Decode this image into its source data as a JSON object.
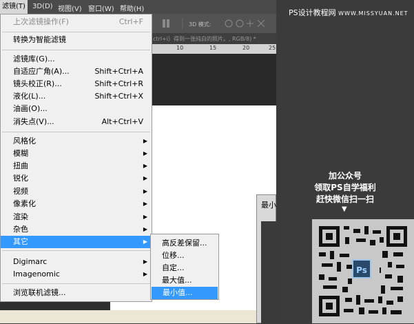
{
  "menubar": {
    "items": [
      "滤镜(T)",
      "3D(D)",
      "视图(V)",
      "窗口(W)",
      "帮助(H)"
    ]
  },
  "optbar": {
    "mode_label": "3D 模式:"
  },
  "tabstrip": {
    "text": "ctrl+i）得到一张纯白的照片。, RGB/8) *"
  },
  "ruler": {
    "ticks": [
      "10",
      "15",
      "20",
      "25"
    ]
  },
  "filter_menu": {
    "last_filter": {
      "label": "上次滤镜操作(F)",
      "shortcut": "Ctrl+F"
    },
    "smart_filter": "转换为智能滤镜",
    "tools": [
      {
        "label": "滤镜库(G)...",
        "shortcut": ""
      },
      {
        "label": "自适应广角(A)...",
        "shortcut": "Shift+Ctrl+A"
      },
      {
        "label": "镜头校正(R)...",
        "shortcut": "Shift+Ctrl+R"
      },
      {
        "label": "液化(L)...",
        "shortcut": "Shift+Ctrl+X"
      },
      {
        "label": "油画(O)...",
        "shortcut": ""
      },
      {
        "label": "消失点(V)...",
        "shortcut": "Alt+Ctrl+V"
      }
    ],
    "groups": [
      "风格化",
      "模糊",
      "扭曲",
      "锐化",
      "视频",
      "像素化",
      "渲染",
      "杂色",
      "其它"
    ],
    "plugins": [
      "Digimarc",
      "Imagenomic"
    ],
    "browse": "浏览联机滤镜..."
  },
  "submenu_other": {
    "items": [
      "高反差保留...",
      "位移...",
      "自定...",
      "最大值...",
      "最小值..."
    ],
    "selected": "最小值..."
  },
  "dialog": {
    "title": "最小"
  },
  "right_panel": {
    "brand": "PS设计教程网",
    "site": "WWW.MISSYUAN.NET",
    "promo": [
      "加公众号",
      "领取PS自学福利",
      "赶快微信扫一扫"
    ],
    "arrow": "▼",
    "ps_logo": "Ps"
  },
  "colors": {
    "highlight": "#3399ff",
    "menu_bg": "#f0f0f0"
  }
}
